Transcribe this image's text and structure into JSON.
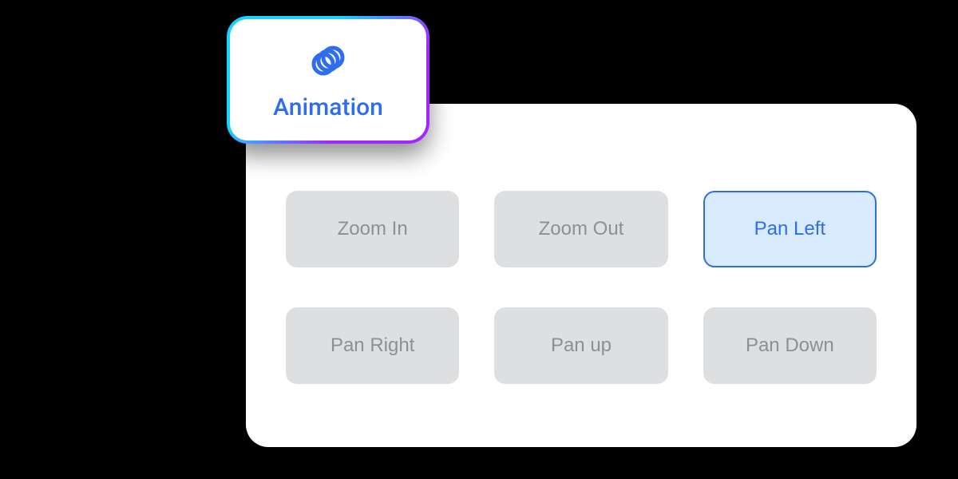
{
  "tab": {
    "title": "Animation",
    "icon_name": "animation-rings-icon"
  },
  "options": [
    {
      "label": "Zoom In",
      "selected": false
    },
    {
      "label": "Zoom  Out",
      "selected": false
    },
    {
      "label": "Pan Left",
      "selected": true
    },
    {
      "label": "Pan Right",
      "selected": false
    },
    {
      "label": "Pan up",
      "selected": false
    },
    {
      "label": "Pan Down",
      "selected": false
    }
  ],
  "colors": {
    "accent": "#2f6def",
    "gradient_start": "#17d1ff",
    "gradient_end": "#a326ff"
  }
}
